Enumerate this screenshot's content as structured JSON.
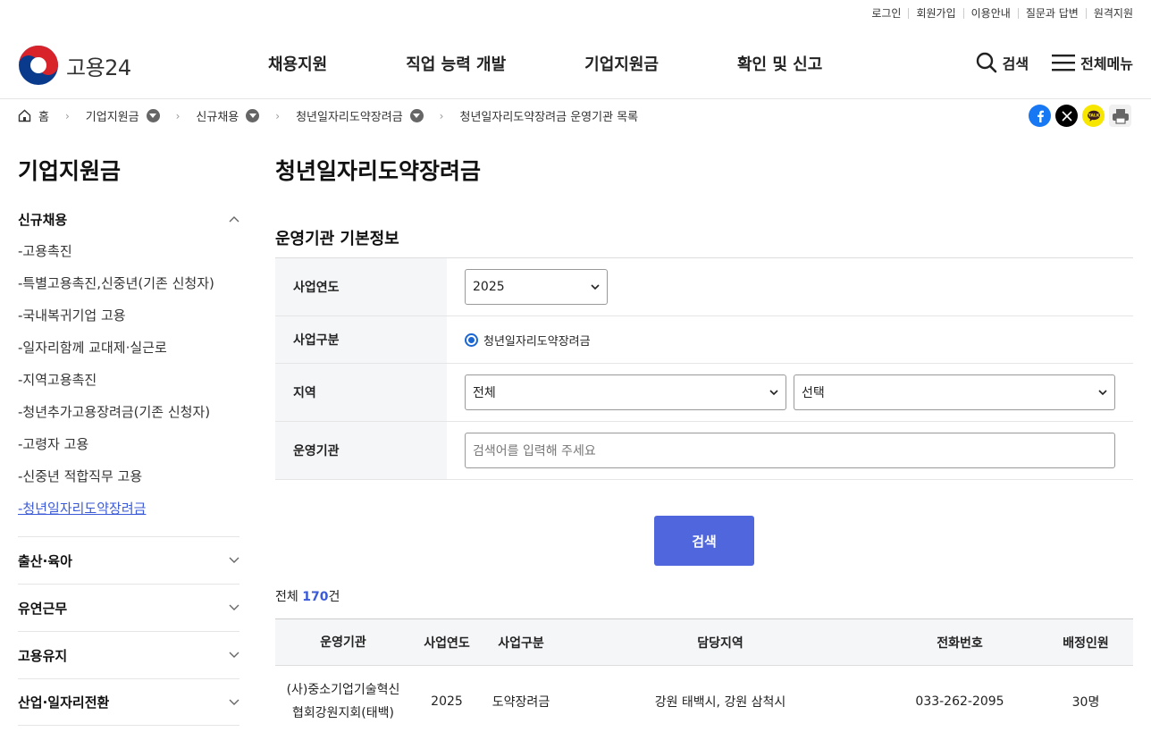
{
  "util_links": [
    "로그인",
    "회원가입",
    "이용안내",
    "질문과 답변",
    "원격지원"
  ],
  "logo": {
    "text": "고용24"
  },
  "gnb": [
    "채용지원",
    "직업 능력 개발",
    "기업지원금",
    "확인 및 신고"
  ],
  "header_buttons": {
    "search": "검색",
    "menu": "전체메뉴"
  },
  "breadcrumb": {
    "home": "홈",
    "items": [
      "기업지원금",
      "신규채용",
      "청년일자리도약장려금"
    ],
    "current": "청년일자리도약장려금 운영기관 목록"
  },
  "share": [
    {
      "icon": "facebook-icon",
      "color": "#1877f2"
    },
    {
      "icon": "x-icon",
      "color": "#000000"
    },
    {
      "icon": "kakaotalk-icon",
      "color": "#f7e600"
    },
    {
      "icon": "print-icon",
      "color": "#666666"
    }
  ],
  "sidebar": {
    "title": "기업지원금",
    "open_group": "신규채용",
    "sub_items": [
      "-고용촉진",
      "-특별고용촉진,신중년(기존 신청자)",
      "-국내복귀기업 고용",
      "-일자리함께 교대제·실근로",
      "-지역고용촉진",
      "-청년추가고용장려금(기존 신청자)",
      "-고령자 고용",
      "-신중년 적합직무 고용",
      "-청년일자리도약장려금"
    ],
    "active_index": 8,
    "groups": [
      "출산·육아",
      "유연근무",
      "고용유지",
      "산업·일자리전환"
    ]
  },
  "main": {
    "title": "청년일자리도약장려금",
    "section_title": "운영기관 기본정보",
    "form": {
      "year_label": "사업연도",
      "year_value": "2025",
      "type_label": "사업구분",
      "type_value": "청년일자리도약장려금",
      "region_label": "지역",
      "region1_value": "전체",
      "region2_value": "선택",
      "org_label": "운영기관",
      "org_placeholder": "검색어를 입력해 주세요"
    },
    "search_button": "검색",
    "total_prefix": "전체 ",
    "total_count": "170",
    "total_suffix": "건"
  },
  "table": {
    "headers": [
      "운영기관",
      "사업연도",
      "사업구분",
      "담당지역",
      "전화번호",
      "배정인원"
    ],
    "rows": [
      {
        "org_line1": "(사)중소기업기술혁신",
        "org_line2": "협회강원지회(태백)",
        "year": "2025",
        "type": "도약장려금",
        "region": "강원 태백시, 강원 삼척시",
        "phone": "033-262-2095",
        "quota": "30명"
      }
    ]
  },
  "colors": {
    "accent": "#4f66dd",
    "active_link": "#3b5ad7"
  }
}
